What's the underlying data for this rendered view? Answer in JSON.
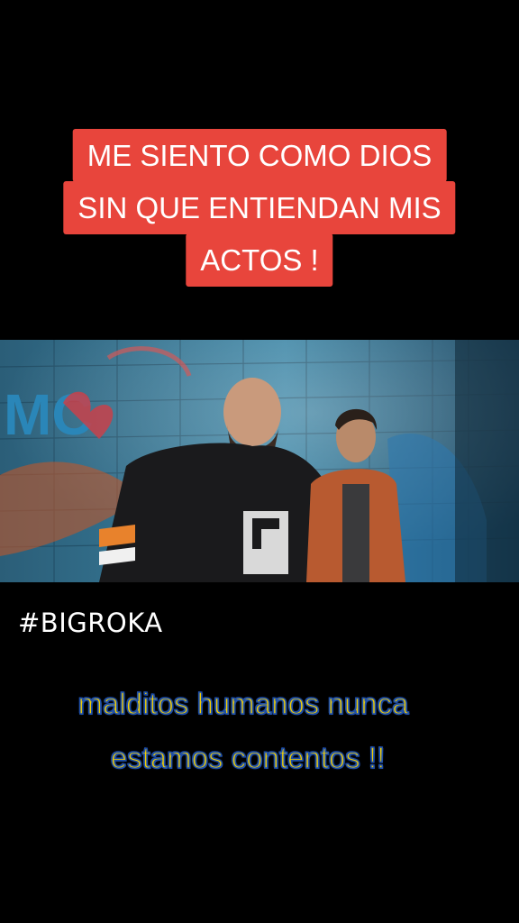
{
  "top_caption": {
    "line1": "ME SIENTO COMO DIOS",
    "line2": "SIN QUE ENTIENDAN MIS",
    "line3": "ACTOS !"
  },
  "hashtag": "#BIGROKA",
  "subtitle": {
    "line1": "malditos humanos nunca",
    "line2": "estamos contentos !!"
  },
  "colors": {
    "caption_bg": "#e8453c",
    "subtitle_fill": "#f5d000",
    "subtitle_outline": "#1f4fa8"
  },
  "video": {
    "wall_graffiti_text": "MC"
  }
}
